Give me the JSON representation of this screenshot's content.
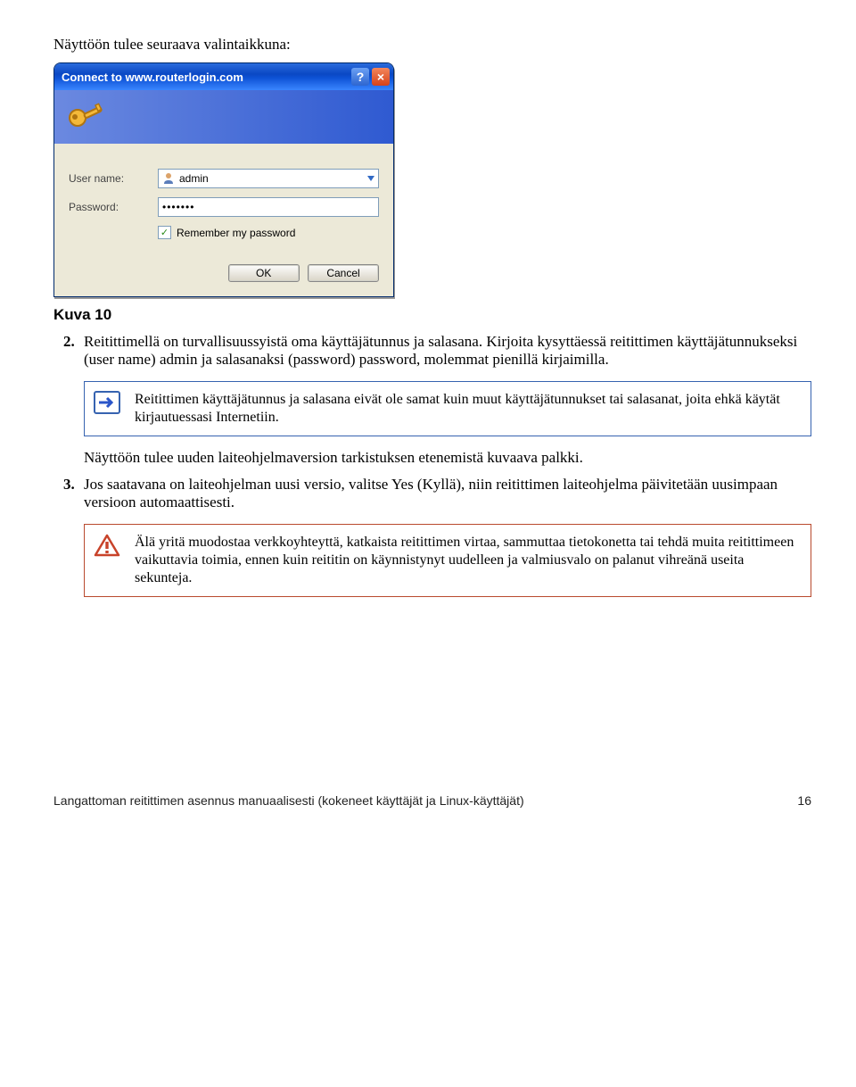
{
  "intro": "Näyttöön tulee seuraava valintaikkuna:",
  "dialog": {
    "title": "Connect to www.routerlogin.com",
    "userLabel": "User name:",
    "userValue": "admin",
    "passLabel": "Password:",
    "passValue": "•••••••",
    "remember": "Remember my password",
    "ok": "OK",
    "cancel": "Cancel"
  },
  "caption": "Kuva 10",
  "steps": {
    "s2": "Reitittimellä on turvallisuussyistä oma käyttäjätunnus ja salasana. Kirjoita kysyttäessä reitittimen käyttäjätunnukseksi (user name) admin ja salasanaksi (password) password, molemmat pienillä kirjaimilla.",
    "s3": "Jos saatavana on laiteohjelman uusi versio, valitse Yes (Kyllä), niin reitittimen laiteohjelma päivitetään uusimpaan versioon automaattisesti."
  },
  "note": "Reitittimen käyttäjätunnus ja salasana eivät ole samat kuin muut käyttäjätunnukset tai salasanat, joita ehkä käytät kirjautuessasi Internetiin.",
  "midPara": "Näyttöön tulee uuden laiteohjelmaversion tarkistuksen etenemistä kuvaava palkki.",
  "warning": "Älä yritä muodostaa verkkoyhteyttä, katkaista reitittimen virtaa, sammuttaa tietokonetta tai tehdä muita reitittimeen vaikuttavia toimia, ennen kuin reititin on käynnistynyt uudelleen ja valmiusvalo on palanut vihreänä useita sekunteja.",
  "footer": {
    "left": "Langattoman reitittimen asennus manuaalisesti (kokeneet käyttäjät ja Linux-käyttäjät)",
    "right": "16"
  }
}
